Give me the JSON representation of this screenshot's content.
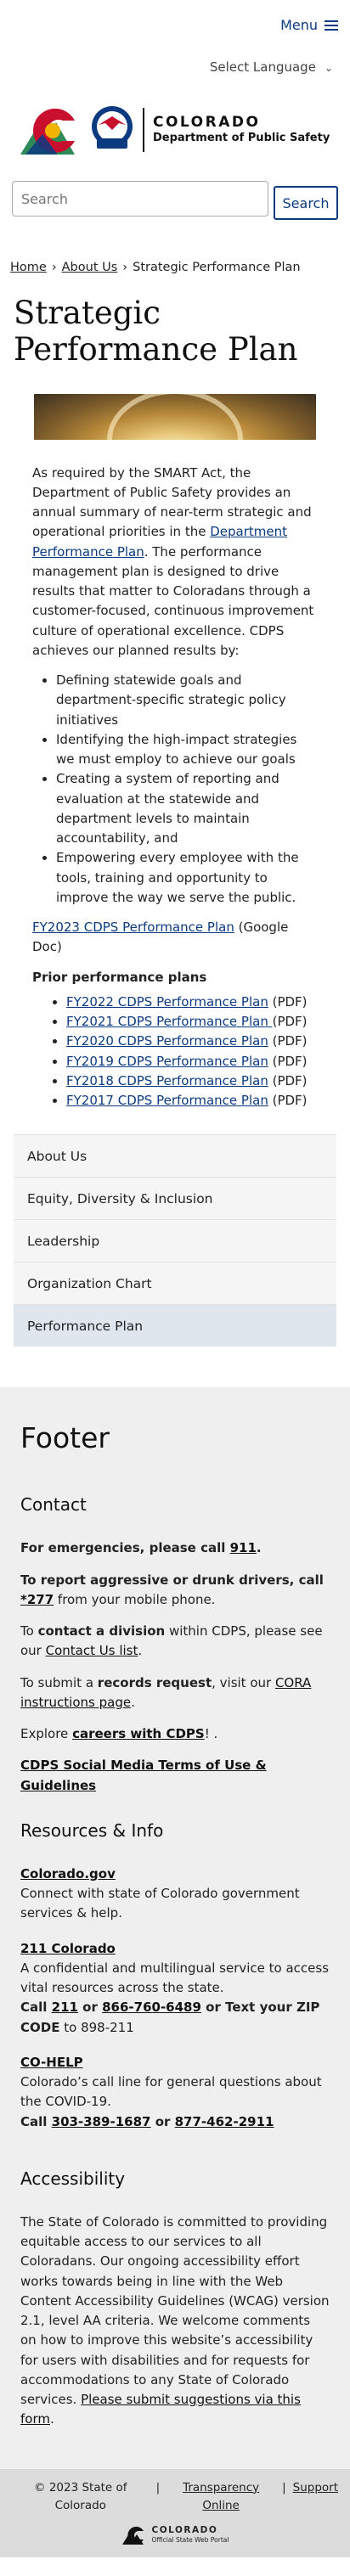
{
  "header": {
    "menu_label": "Menu",
    "language_label": "Select Language",
    "logo_line1": "COLORADO",
    "logo_line2": "Department of Public Safety",
    "cdps_badge": "CDPS",
    "search_placeholder": "Search",
    "search_button": "Search"
  },
  "breadcrumb": {
    "home": "Home",
    "about": "About Us",
    "current": "Strategic Performance Plan",
    "sep": "›"
  },
  "page": {
    "title": "Strategic Performance Plan",
    "intro_1": "As required by the SMART Act, the Department of Public Safety provides an annual summary of near-term strategic and operational priorities in the ",
    "intro_link": "Department Performance Plan",
    "intro_2": ". The performance management plan is designed to drive results that matter to Coloradans through a customer-focused, continuous improvement culture of operational excellence. CDPS achieves our planned results by:",
    "bullets": [
      "Defining statewide goals and department-specific strategic policy initiatives",
      "Identifying the high-impact strategies we must employ to achieve our goals",
      "Creating a system of reporting and evaluation at the statewide and department levels to maintain accountability, and",
      "Empowering every employee with the tools, training and opportunity to improve the way we serve the public."
    ],
    "current_plan_link": "FY2023 CDPS Performance Plan",
    "current_plan_suffix": " (Google Doc)",
    "prior_heading": "Prior performance plans",
    "prior_plans": [
      {
        "link": "FY2022 CDPS Performance Plan",
        "suffix": " (PDF)"
      },
      {
        "link": "FY2021 CDPS Performance Plan ",
        "suffix": " (PDF)"
      },
      {
        "link": "FY2020 CDPS Performance Plan",
        "suffix": " (PDF)"
      },
      {
        "link": "FY2019 CDPS Performance Plan",
        "suffix": " (PDF)"
      },
      {
        "link": "FY2018 CDPS Performance Plan",
        "suffix": " (PDF)"
      },
      {
        "link": "FY2017 CDPS Performance Plan",
        "suffix": " (PDF)"
      }
    ]
  },
  "side_nav": {
    "items": [
      "About Us",
      "Equity, Diversity & Inclusion",
      "Leadership",
      "Organization Chart",
      "Performance Plan"
    ]
  },
  "footer": {
    "title": "Footer",
    "contact": {
      "heading": "Contact",
      "emergency_pre": "For emergencies, please call ",
      "emergency_num": "911",
      "emergency_post": ".",
      "report_pre": "To report aggressive or drunk drivers, call ",
      "report_num": "*277",
      "report_post": " from your mobile phone.",
      "division_pre": "To ",
      "division_bold": "contact a division",
      "division_mid": " within CDPS, please see our ",
      "division_link": "Contact Us list",
      "division_post": ".",
      "records_pre": "To submit a ",
      "records_bold": "records request",
      "records_mid": ", visit our ",
      "records_link": "CORA instructions page",
      "records_post": ".",
      "careers_pre": "Explore ",
      "careers_link": "careers with CDPS",
      "careers_post": "! .",
      "social_link": "CDPS Social Media Terms of Use & Guidelines"
    },
    "resources": {
      "heading": "Resources & Info",
      "cogov_title": "Colorado.gov",
      "cogov_desc": "Connect with state of Colorado government services & help.",
      "co211_title": "211 Colorado",
      "co211_desc": "A confidential and multilingual service to access vital resources across the state.",
      "co211_call": "Call ",
      "co211_num1": "211",
      "co211_or": " or ",
      "co211_num2": "866-760-6489",
      "co211_text": " or Text your ZIP CODE",
      "co211_to": " to 898-211",
      "cohelp_title": "CO-HELP",
      "cohelp_desc": "Colorado’s call line for general questions about the COVID-19.",
      "cohelp_call": "Call ",
      "cohelp_num1": "303-389-1687",
      "cohelp_or": " or ",
      "cohelp_num2": "877-462-2911"
    },
    "accessibility": {
      "heading": "Accessibility",
      "text": "The State of Colorado is committed to providing equitable access to our services to all Coloradans. Our ongoing accessibility effort works towards being in line with the Web Content Accessibility Guidelines (WCAG) version 2.1, level AA criteria. We welcome comments on how to improve this website’s accessibility for users with disabilities and for requests for accommodations to any State of Colorado services. ",
      "link": "Please submit suggestions via this form",
      "post": "."
    }
  },
  "bottom_bar": {
    "copyright": "© 2023 State of Colorado",
    "sep": "|",
    "transparency": "Transparency Online",
    "support": "Support",
    "mark_line1": "COLORADO",
    "mark_line2": "Official State Web Portal"
  },
  "colors": {
    "link": "#0b3a80",
    "logo_red": "#c8102e",
    "logo_blue": "#0b3a80",
    "logo_gold": "#f2b400",
    "logo_green": "#2e8b57"
  }
}
